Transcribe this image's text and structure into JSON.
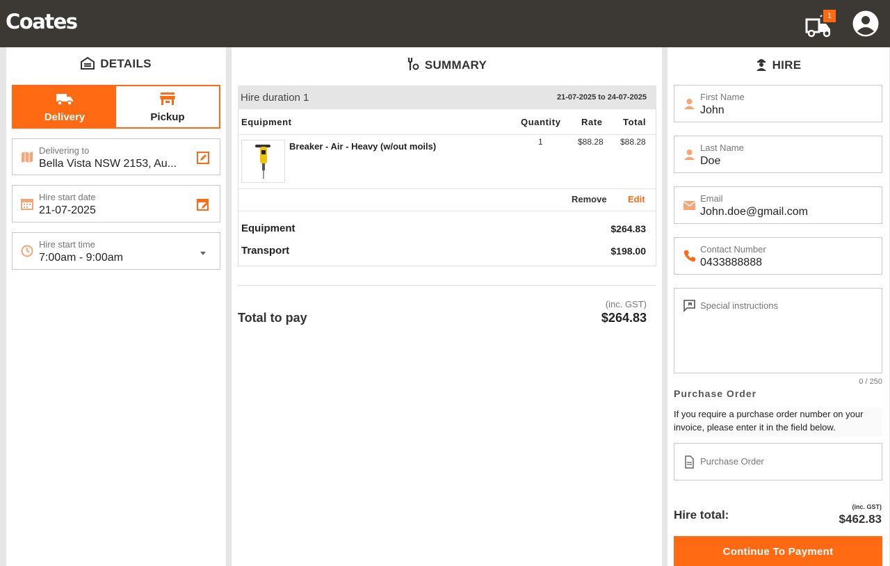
{
  "header": {
    "logo": "Coates",
    "cart_count": "1"
  },
  "details": {
    "title": "DETAILS",
    "modes": [
      {
        "label": "Delivery",
        "active": true
      },
      {
        "label": "Pickup",
        "active": false
      }
    ],
    "delivering_to": {
      "label": "Delivering to",
      "value": "Bella Vista NSW 2153, Au..."
    },
    "hire_start_date": {
      "label": "Hire start date",
      "value": "21-07-2025"
    },
    "hire_start_time": {
      "label": "Hire start time",
      "value": "7:00am - 9:00am"
    }
  },
  "summary": {
    "title": "SUMMARY",
    "hire_duration": {
      "label": "Hire duration 1",
      "dates": "21-07-2025 to 24-07-2025"
    },
    "columns": [
      "Equipment",
      "Quantity",
      "Rate",
      "Total"
    ],
    "items": [
      {
        "name": "Breaker - Air - Heavy (w/out moils)",
        "quantity": "1",
        "rate": "$88.28",
        "total": "$88.28"
      }
    ],
    "remove_label": "Remove",
    "edit_label": "Edit",
    "equipment_label": "Equipment",
    "equipment_total": "$264.83",
    "transport_label": "Transport",
    "transport_total": "$198.00",
    "total_label": "Total to pay",
    "total_gst": "(inc. GST)",
    "total_value": "$264.83"
  },
  "hire": {
    "title": "HIRE",
    "first_name": {
      "label": "First Name",
      "value": "John"
    },
    "last_name": {
      "label": "Last Name",
      "value": "Doe"
    },
    "email": {
      "label": "Email",
      "value": "John.doe@gmail.com"
    },
    "contact": {
      "label": "Contact Number",
      "value": "0433888888"
    },
    "special_instructions": {
      "placeholder": "Special instructions",
      "counter": "0 / 250"
    },
    "purchase_order": {
      "title": "Purchase Order",
      "description": "If you require a purchase order number on your invoice, please enter it in the field below.",
      "placeholder": "Purchase Order"
    },
    "hire_total_label": "Hire total:",
    "hire_total_gst": "(inc. GST)",
    "hire_total_value": "$462.83",
    "continue_label": "Continue To Payment"
  },
  "colors": {
    "accent": "#ff6a13",
    "topbar": "#3c3834"
  }
}
